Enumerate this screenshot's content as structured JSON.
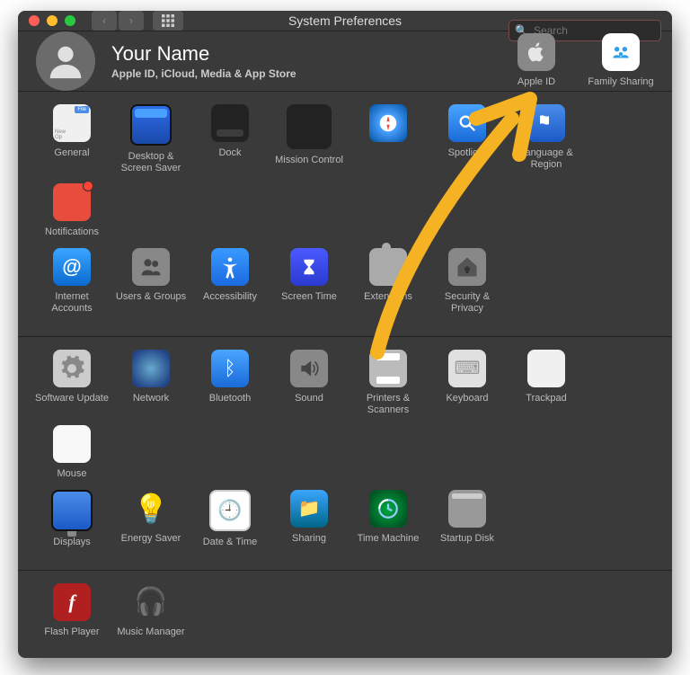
{
  "window": {
    "title": "System Preferences"
  },
  "search": {
    "placeholder": "Search"
  },
  "user": {
    "name": "Your Name",
    "subtitle": "Apple ID, iCloud, Media & App Store"
  },
  "header_icons": {
    "apple_id": "Apple ID",
    "family": "Family Sharing"
  },
  "rows": [
    [
      {
        "id": "general",
        "label": "General"
      },
      {
        "id": "desktop",
        "label": "Desktop & Screen Saver"
      },
      {
        "id": "dock",
        "label": "Dock"
      },
      {
        "id": "mission",
        "label": "Mission Control"
      },
      {
        "id": "safari",
        "label": ""
      },
      {
        "id": "spotlight",
        "label": "Spotlight"
      },
      {
        "id": "language",
        "label": "Language & Region"
      },
      {
        "id": "notifications",
        "label": "Notifications"
      }
    ],
    [
      {
        "id": "internet",
        "label": "Internet Accounts"
      },
      {
        "id": "users",
        "label": "Users & Groups"
      },
      {
        "id": "accessibility",
        "label": "Accessibility"
      },
      {
        "id": "screentime",
        "label": "Screen Time"
      },
      {
        "id": "extensions",
        "label": "Extensions"
      },
      {
        "id": "security",
        "label": "Security & Privacy"
      }
    ],
    [
      {
        "id": "software",
        "label": "Software Update"
      },
      {
        "id": "network",
        "label": "Network"
      },
      {
        "id": "bluetooth",
        "label": "Bluetooth"
      },
      {
        "id": "sound",
        "label": "Sound"
      },
      {
        "id": "printers",
        "label": "Printers & Scanners"
      },
      {
        "id": "keyboard",
        "label": "Keyboard"
      },
      {
        "id": "trackpad",
        "label": "Trackpad"
      },
      {
        "id": "mouse",
        "label": "Mouse"
      }
    ],
    [
      {
        "id": "displays",
        "label": "Displays"
      },
      {
        "id": "energy",
        "label": "Energy Saver"
      },
      {
        "id": "datetime",
        "label": "Date & Time"
      },
      {
        "id": "sharing",
        "label": "Sharing"
      },
      {
        "id": "timemachine",
        "label": "Time Machine"
      },
      {
        "id": "startup",
        "label": "Startup Disk"
      }
    ],
    [
      {
        "id": "flash",
        "label": "Flash Player"
      },
      {
        "id": "music",
        "label": "Music Manager"
      }
    ]
  ],
  "colors": {
    "window_bg": "#3a3a3a",
    "accent_blue": "#1a6ad8",
    "annotation": "#f5b323"
  }
}
